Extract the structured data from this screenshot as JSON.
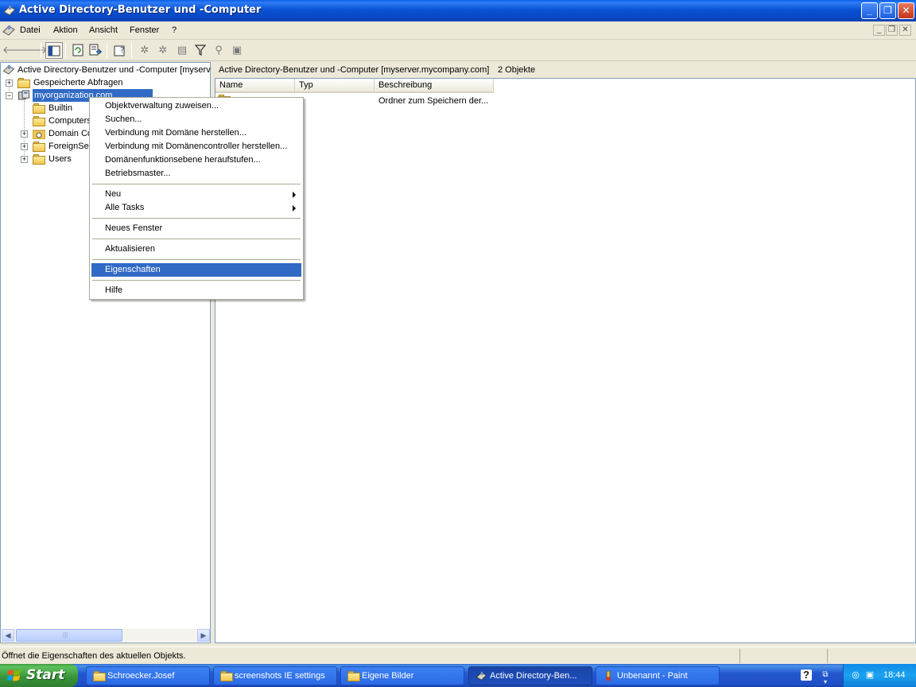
{
  "window": {
    "title": "Active Directory-Benutzer und -Computer",
    "buttons": {
      "minimize": "_",
      "restore": "❐",
      "close": "✕"
    }
  },
  "menu": {
    "items": [
      "Datei",
      "Aktion",
      "Ansicht",
      "Fenster",
      "?"
    ],
    "mdi": {
      "minimize": "_",
      "restore": "❐",
      "close": "✕"
    }
  },
  "toolbar": {
    "back": "🡐",
    "forward": "🡒",
    "icons": [
      "console-tree-icon",
      "refresh-icon",
      "export-list-icon",
      "properties-icon",
      "add-user-icon",
      "add-group-icon",
      "add-ou-icon",
      "filter-icon",
      "find-icon",
      "add-to-group-icon"
    ]
  },
  "tree": {
    "root": "Active Directory-Benutzer und -Computer [myserv",
    "items": [
      {
        "label": "Gespeicherte Abfragen",
        "expander": "+"
      },
      {
        "label": "myorganization.com",
        "expander": "−",
        "selected": true
      },
      {
        "label": "Builtin"
      },
      {
        "label": "Computers"
      },
      {
        "label": "Domain Co",
        "expander": "+"
      },
      {
        "label": "ForeignSec",
        "expander": "+"
      },
      {
        "label": "Users",
        "expander": "+"
      }
    ]
  },
  "scroll": {
    "left": "◀",
    "right": "▶",
    "grip": "|||"
  },
  "right": {
    "header_path": "Active Directory-Benutzer und -Computer [myserver.mycompany.com]",
    "header_count": "2 Objekte",
    "columns": [
      "Name",
      "Typ",
      "Beschreibung"
    ],
    "row_description": "Ordner zum Speichern der..."
  },
  "context_menu": {
    "items": [
      "Objektverwaltung zuweisen...",
      "Suchen...",
      "Verbindung mit Domäne herstellen...",
      "Verbindung mit Domänencontroller herstellen...",
      "Domänenfunktionsebene heraufstufen...",
      "Betriebsmaster...",
      "Neu",
      "Alle Tasks",
      "Neues Fenster",
      "Aktualisieren",
      "Eigenschaften",
      "Hilfe"
    ],
    "highlighted": "Eigenschaften"
  },
  "status": {
    "text": "Öffnet die Eigenschaften des aktuellen Objekts."
  },
  "taskbar": {
    "start": "Start",
    "tasks": [
      "Schroecker.Josef",
      "screenshots IE settings",
      "Eigene Bilder",
      "Active Directory-Ben...",
      "Unbenannt - Paint"
    ],
    "active_task": "Active Directory-Ben...",
    "tray_icons": [
      "help-icon",
      "restore-icon",
      "chevron-icon"
    ],
    "clock": "18:44"
  },
  "colors": {
    "accent": "#316ac5",
    "titlebar": "#0a5fe8",
    "taskbar": "#2458d0",
    "start": "#3a963a"
  }
}
